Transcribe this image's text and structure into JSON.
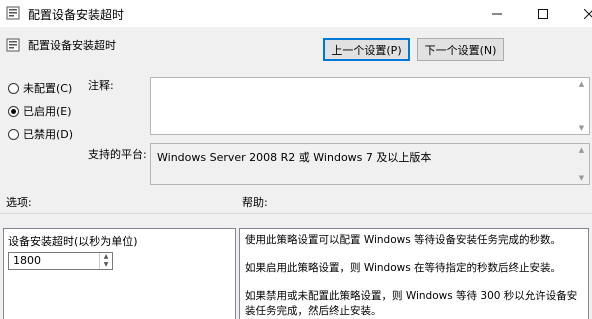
{
  "window": {
    "title": "配置设备安装超时",
    "icon": "policy-setting-icon",
    "controls": [
      "minimize",
      "maximize",
      "close"
    ]
  },
  "header": {
    "title": "配置设备安装超时",
    "icon": "policy-setting-icon"
  },
  "nav": {
    "prev_label": "上一个设置(P)",
    "next_label": "下一个设置(N)"
  },
  "state": {
    "options": [
      {
        "label": "未配置(C)",
        "checked": false
      },
      {
        "label": "已启用(E)",
        "checked": true
      },
      {
        "label": "已禁用(D)",
        "checked": false
      }
    ]
  },
  "comment": {
    "label": "注释:",
    "value": ""
  },
  "platform": {
    "label": "支持的平台:",
    "value": "Windows Server 2008 R2 或 Windows 7 及以上版本"
  },
  "options_section": {
    "label": "选项:",
    "timeout_label": "设备安装超时(以秒为单位)",
    "timeout_value": "1800"
  },
  "help_section": {
    "label": "帮助:",
    "paragraphs": [
      "使用此策略设置可以配置 Windows 等待设备安装任务完成的秒数。",
      "如果启用此策略设置，则 Windows 在等待指定的秒数后终止安装。",
      "如果禁用或未配置此策略设置，则 Windows 等待 300 秒以允许设备安装任务完成，然后终止安装。"
    ]
  },
  "colors": {
    "window_bg": "#f0f0f0",
    "titlebar_bg": "#ffffff",
    "focus_border": "#0078d7"
  }
}
